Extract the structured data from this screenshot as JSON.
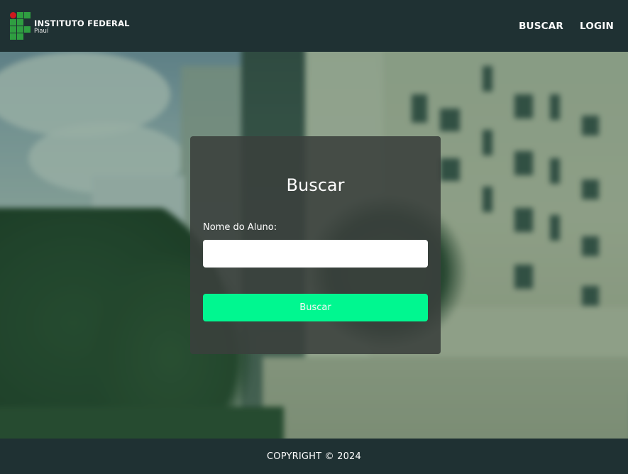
{
  "header": {
    "logo": {
      "title": "INSTITUTO FEDERAL",
      "subtitle": "Piauí"
    },
    "nav": [
      {
        "label": "BUSCAR"
      },
      {
        "label": "LOGIN"
      }
    ]
  },
  "search_card": {
    "title": "Buscar",
    "field_label": "Nome do Aluno:",
    "input_value": "",
    "input_placeholder": "",
    "button_label": "Buscar"
  },
  "footer": {
    "text": "COPYRIGHT © 2024"
  },
  "colors": {
    "header_bg": "#1f3133",
    "button_bg": "#00ff94",
    "logo_green": "#2f9e41",
    "logo_red": "#cd191e"
  },
  "icons": {
    "logo": "instituto-federal-logo-icon"
  }
}
